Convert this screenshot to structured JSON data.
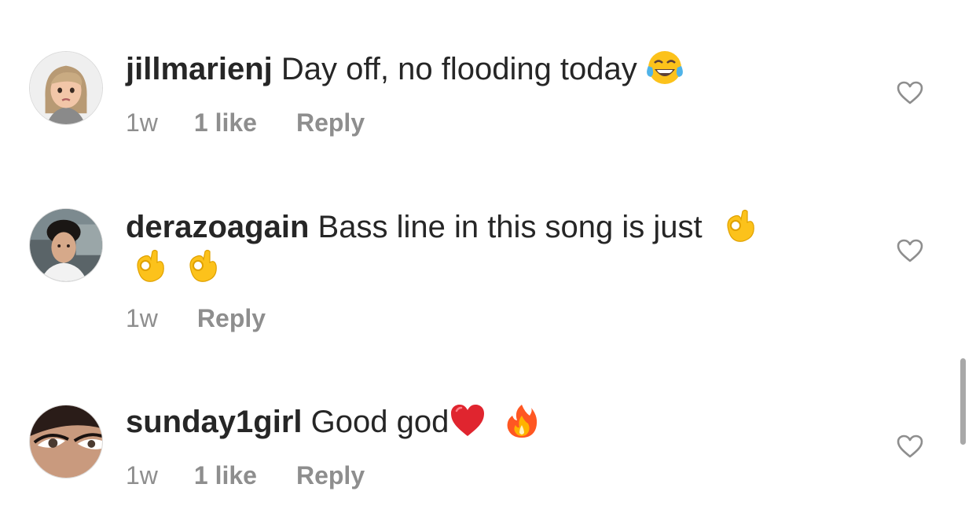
{
  "comments": [
    {
      "username": "jillmarienj",
      "text": "Day off, no flooding today",
      "emoji": "face-with-tears-of-joy",
      "time": "1w",
      "likes": "1 like",
      "reply": "Reply"
    },
    {
      "username": "derazoagain",
      "text": "Bass line in this song is just",
      "emoji": "ok-hand",
      "time": "1w",
      "reply": "Reply"
    },
    {
      "username": "sunday1girl",
      "text": "Good god",
      "emoji": "red-heart fire",
      "time": "1w",
      "likes": "1 like",
      "reply": "Reply"
    }
  ],
  "colors": {
    "text": "#262626",
    "secondary": "#8e8e8e",
    "scrollbar": "#a8a8a8"
  },
  "icons": [
    "heart-outline-icon",
    "avatar"
  ]
}
